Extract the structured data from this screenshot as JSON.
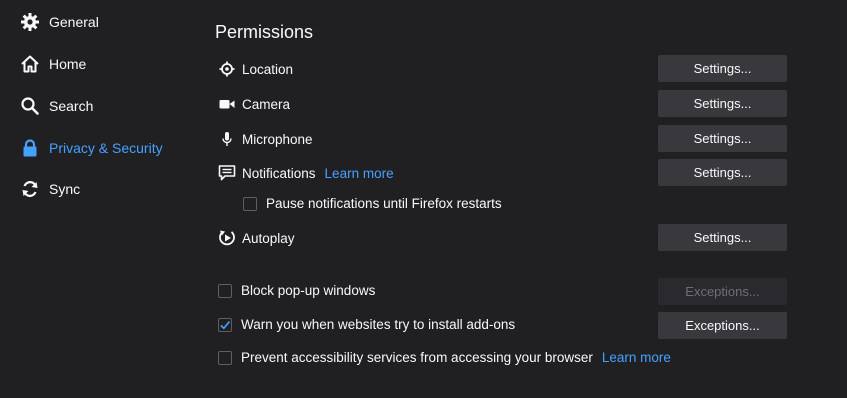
{
  "colors": {
    "background": "#202023",
    "accent": "#45a1ff",
    "button": "#38383d",
    "text": "#f9f9fa"
  },
  "sidebar": {
    "items": [
      {
        "label": "General",
        "icon": "gear-icon"
      },
      {
        "label": "Home",
        "icon": "home-icon"
      },
      {
        "label": "Search",
        "icon": "search-icon"
      },
      {
        "label": "Privacy & Security",
        "icon": "lock-icon",
        "active": true
      },
      {
        "label": "Sync",
        "icon": "sync-icon"
      }
    ]
  },
  "permissions": {
    "heading": "Permissions",
    "rows": [
      {
        "label": "Location",
        "icon": "location-icon",
        "button": "Settings..."
      },
      {
        "label": "Camera",
        "icon": "camera-icon",
        "button": "Settings..."
      },
      {
        "label": "Microphone",
        "icon": "microphone-icon",
        "button": "Settings..."
      },
      {
        "label": "Notifications",
        "icon": "notifications-icon",
        "button": "Settings...",
        "link": "Learn more"
      },
      {
        "label": "Autoplay",
        "icon": "autoplay-icon",
        "button": "Settings..."
      }
    ],
    "pause_notifications": {
      "label": "Pause notifications until Firefox restarts",
      "checked": false
    },
    "block_popups": {
      "label": "Block pop-up windows",
      "checked": false,
      "button": "Exceptions...",
      "button_disabled": true
    },
    "warn_addons": {
      "label": "Warn you when websites try to install add-ons",
      "checked": true,
      "button": "Exceptions..."
    },
    "prevent_accessibility": {
      "label": "Prevent accessibility services from accessing your browser",
      "checked": false,
      "link": "Learn more"
    }
  }
}
